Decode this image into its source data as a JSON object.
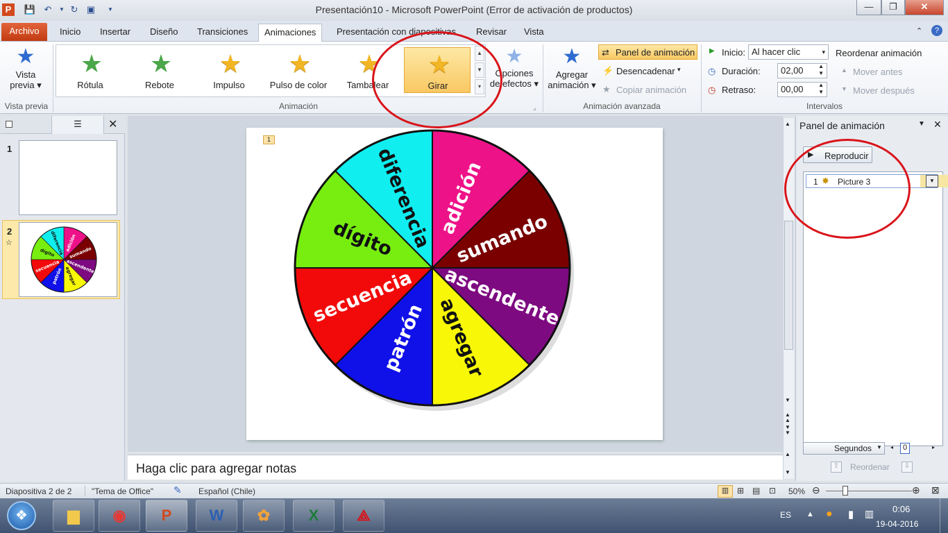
{
  "window": {
    "title": "Presentación10 - Microsoft PowerPoint (Error de activación de productos)"
  },
  "tabs": [
    {
      "label": "Archivo"
    },
    {
      "label": "Inicio"
    },
    {
      "label": "Insertar"
    },
    {
      "label": "Diseño"
    },
    {
      "label": "Transiciones"
    },
    {
      "label": "Animaciones"
    },
    {
      "label": "Presentación con diapositivas"
    },
    {
      "label": "Revisar"
    },
    {
      "label": "Vista"
    }
  ],
  "ribbon": {
    "preview": {
      "label1": "Vista",
      "label2": "previa",
      "group": "Vista previa"
    },
    "animations": [
      {
        "label": "Rótula"
      },
      {
        "label": "Rebote"
      },
      {
        "label": "Impulso"
      },
      {
        "label": "Pulso de color"
      },
      {
        "label": "Tambalear"
      },
      {
        "label": "Girar"
      }
    ],
    "effect_options1": "Opciones",
    "effect_options2": "de efectos",
    "animation_group": "Animación",
    "add_animation1": "Agregar",
    "add_animation2": "animación",
    "animation_pane": "Panel de animación",
    "trigger": "Desencadenar",
    "copy_animation": "Copiar animación",
    "advanced_group": "Animación avanzada",
    "start_label": "Inicio:",
    "start_value": "Al hacer clic",
    "duration_label": "Duración:",
    "duration_value": "02,00",
    "delay_label": "Retraso:",
    "delay_value": "00,00",
    "reorder": "Reordenar animación",
    "move_earlier": "Mover antes",
    "move_later": "Mover después",
    "timing_group": "Intervalos"
  },
  "slides": {
    "items": [
      {
        "num": "1"
      },
      {
        "num": "2"
      }
    ]
  },
  "slide": {
    "anim_tag": "1",
    "wheel": [
      {
        "text": "adición",
        "color": "#ee1289"
      },
      {
        "text": "sumando",
        "color": "#7a0000"
      },
      {
        "text": "ascendente",
        "color": "#7d0a80"
      },
      {
        "text": "agregar",
        "color": "#f7f707"
      },
      {
        "text": "patrón",
        "color": "#1010e8"
      },
      {
        "text": "secuencia",
        "color": "#f20a0a"
      },
      {
        "text": "dígito",
        "color": "#77ee10"
      },
      {
        "text": "diferencia",
        "color": "#10eef0"
      }
    ]
  },
  "notes": {
    "placeholder": "Haga clic para agregar notas"
  },
  "pane": {
    "title": "Panel de animación",
    "play": "Reproducir",
    "item_num": "1",
    "item_name": "Picture 3",
    "seconds": "Segundos",
    "zoom_value": "0",
    "reorder": "Reordenar"
  },
  "status": {
    "slide": "Diapositiva 2 de 2",
    "theme": "\"Tema de Office\"",
    "language": "Español (Chile)",
    "zoom": "50%"
  },
  "taskbar": {
    "lang": "ES",
    "time": "0:06",
    "date": "19-04-2016"
  },
  "colors": {
    "accent": "#d9141a",
    "file_tab": "#d24a1e"
  }
}
